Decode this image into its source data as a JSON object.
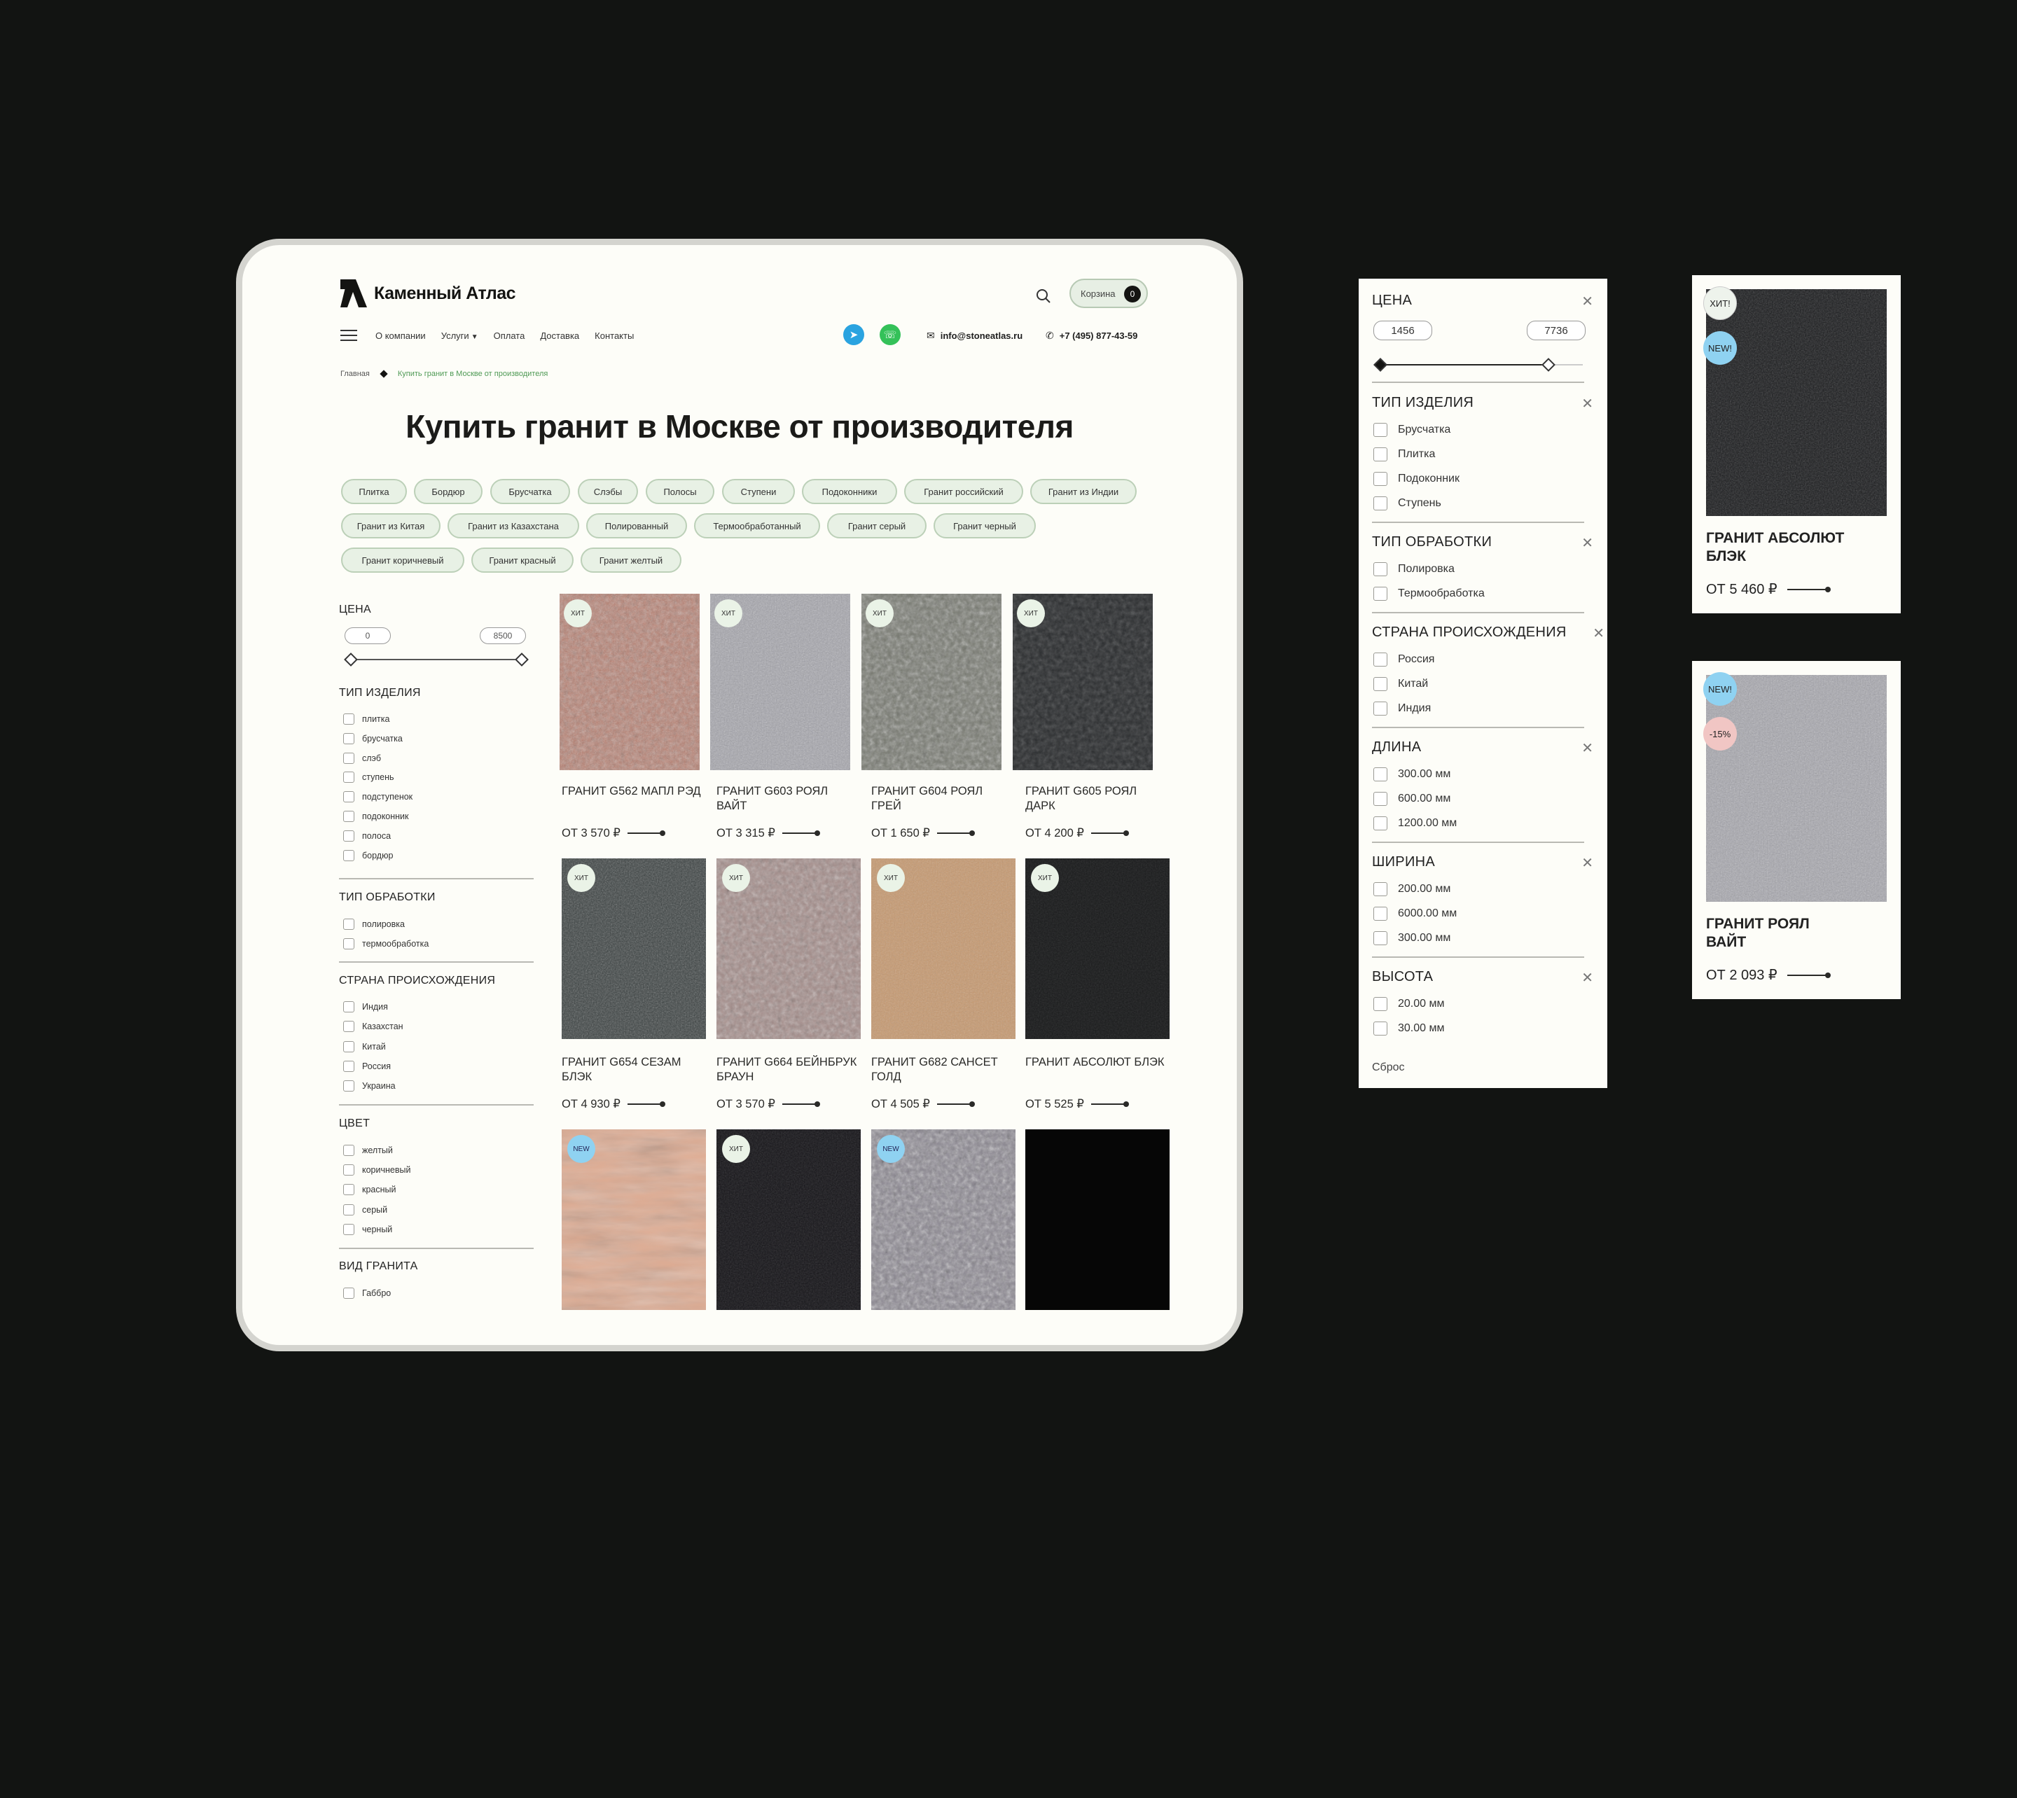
{
  "site": {
    "brand": "Каменный Атлас",
    "cart": {
      "label": "Корзина",
      "count": "0"
    },
    "nav": [
      "О компании",
      "Услуги",
      "Оплата",
      "Доставка",
      "Контакты"
    ],
    "email": "info@stoneatlas.ru",
    "phone": "+7 (495) 877-43-59",
    "breadcrumbs": [
      "Главная",
      "Купить гранит в Москве от производителя"
    ],
    "title": "Купить гранит в Москве от производителя",
    "chips": [
      "Плитка",
      "Бордюр",
      "Брусчатка",
      "Слэбы",
      "Полосы",
      "Ступени",
      "Подоконники",
      "Гранит российский",
      "Гранит из Индии",
      "Гранит из Китая",
      "Гранит из Казахстана",
      "Полированный",
      "Термообработанный",
      "Гранит серый",
      "Гранит черный",
      "Гранит коричневый",
      "Гранит красный",
      "Гранит желтый"
    ],
    "sidebar": {
      "price": {
        "title": "ЦЕНА",
        "min": "0",
        "max": "8500"
      },
      "product_type": {
        "title": "ТИП ИЗДЕЛИЯ",
        "items": [
          "плитка",
          "брусчатка",
          "слэб",
          "ступень",
          "подступенок",
          "подоконник",
          "полоса",
          "бордюр"
        ]
      },
      "processing": {
        "title": "ТИП ОБРАБОТКИ",
        "items": [
          "полировка",
          "термообработка"
        ]
      },
      "country": {
        "title": "СТРАНА ПРОИСХОЖДЕНИЯ",
        "items": [
          "Индия",
          "Казахстан",
          "Китай",
          "Россия",
          "Украина"
        ]
      },
      "color": {
        "title": "ЦВЕТ",
        "items": [
          "желтый",
          "коричневый",
          "красный",
          "серый",
          "черный"
        ]
      },
      "granite_kind": {
        "title": "ВИД ГРАНИТА",
        "items": [
          "Габбро"
        ]
      }
    },
    "products": [
      {
        "name": "ГРАНИТ G562 МАПЛ РЭД",
        "price": "ОТ 3 570 ₽",
        "badge": "ХИТ"
      },
      {
        "name": "ГРАНИТ G603 РОЯЛ ВАЙТ",
        "price": "ОТ 3 315 ₽",
        "badge": "ХИТ"
      },
      {
        "name": "ГРАНИТ G604 РОЯЛ ГРЕЙ",
        "price": "ОТ 1 650 ₽",
        "badge": "ХИТ"
      },
      {
        "name": "ГРАНИТ G605 РОЯЛ ДАРК",
        "price": "ОТ 4 200 ₽",
        "badge": "ХИТ"
      },
      {
        "name": "ГРАНИТ G654 СЕЗАМ БЛЭК",
        "price": "ОТ 4 930 ₽",
        "badge": "ХИТ"
      },
      {
        "name": "ГРАНИТ G664 БЕЙНБРУК БРАУН",
        "price": "ОТ 3 570 ₽",
        "badge": "ХИТ"
      },
      {
        "name": "ГРАНИТ G682 САНСЕТ ГОЛД",
        "price": "ОТ 4 505 ₽",
        "badge": "ХИТ"
      },
      {
        "name": "ГРАНИТ АБСОЛЮТ БЛЭК",
        "price": "ОТ 5 525 ₽",
        "badge": "ХИТ"
      },
      {
        "badge": "NEW"
      },
      {
        "badge": "ХИТ"
      },
      {
        "badge": "NEW"
      },
      {
        "badge": ""
      }
    ]
  },
  "filter_panel": {
    "price": {
      "title": "ЦЕНА",
      "min": "1456",
      "max": "7736"
    },
    "product_type": {
      "title": "ТИП ИЗДЕЛИЯ",
      "items": [
        "Брусчатка",
        "Плитка",
        "Подоконник",
        "Ступень"
      ]
    },
    "processing": {
      "title": "ТИП ОБРАБОТКИ",
      "items": [
        "Полировка",
        "Термообработка"
      ]
    },
    "country": {
      "title": "СТРАНА ПРОИСХОЖДЕНИЯ",
      "items": [
        "Россия",
        "Китай",
        "Индия"
      ]
    },
    "length": {
      "title": "ДЛИНА",
      "items": [
        "300.00 мм",
        "600.00 мм",
        "1200.00 мм"
      ]
    },
    "width": {
      "title": "ШИРИНА",
      "items": [
        "200.00 мм",
        "6000.00 мм",
        "300.00 мм"
      ]
    },
    "height": {
      "title": "ВЫСОТА",
      "items": [
        "20.00 мм",
        "30.00 мм"
      ]
    },
    "reset": "Сброс"
  },
  "cards": [
    {
      "name_line1": "ГРАНИТ АБСОЛЮТ",
      "name_line2": "БЛЭК",
      "price": "ОТ 5 460 ₽",
      "badge1": "ХИТ!",
      "badge2": "NEW!"
    },
    {
      "name_line1": "ГРАНИТ РОЯЛ",
      "name_line2": "ВАЙТ",
      "price": "ОТ 2 093 ₽",
      "badge1": "NEW!",
      "badge2": "-15%"
    }
  ]
}
